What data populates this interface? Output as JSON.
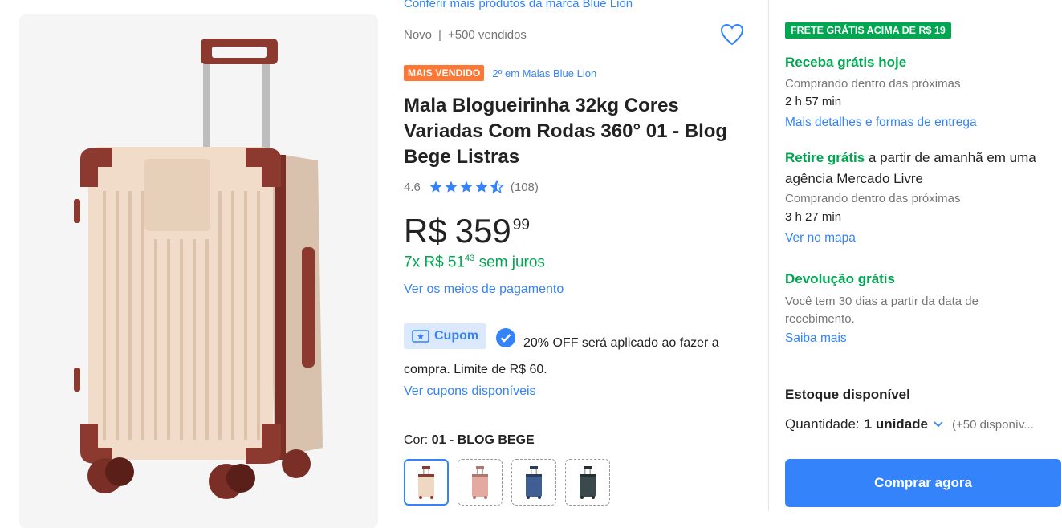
{
  "product": {
    "brand_link": "Conferir mais produtos da marca Blue Lion",
    "condition": "Novo",
    "sold": "+500 vendidos",
    "badge": "MAIS VENDIDO",
    "ranking": "2º em Malas Blue Lion",
    "title": "Mala Blogueirinha 32kg Cores Variadas Com Rodas 360° 01 - Blog Bege Listras",
    "rating": "4.6",
    "stars": 4.6,
    "reviews": "(108)",
    "price_currency": "R$",
    "price_int": "359",
    "price_cents": "99",
    "installments_prefix": "7x R$ 51",
    "installments_cents": "43",
    "installments_suffix": "sem juros",
    "payment_link": "Ver os meios de pagamento",
    "coupon_label": "Cupom",
    "coupon_text": "20% OFF será aplicado ao fazer a compra. Limite de R$ 60.",
    "coupons_link": "Ver cupons disponíveis",
    "color_label": "Cor:",
    "color_value": "01 - BLOG BEGE",
    "color_options": [
      {
        "color": "#eed8c4",
        "trim": "#8a3a2e"
      },
      {
        "color": "#e4a9a0",
        "trim": "#b07770"
      },
      {
        "color": "#3f5e94",
        "trim": "#2a3c5c"
      },
      {
        "color": "#3a4a4c",
        "trim": "#243030"
      }
    ]
  },
  "shipping": {
    "free_badge": "FRETE GRÁTIS ACIMA DE R$ 19",
    "receive_title": "Receba grátis hoje",
    "receive_sub": "Comprando dentro das próximas",
    "receive_time": "2 h 57 min",
    "receive_link": "Mais detalhes e formas de entrega",
    "pickup_bold": "Retire grátis",
    "pickup_text": " a partir de amanhã em uma agência Mercado Livre",
    "pickup_sub": "Comprando dentro das próximas",
    "pickup_time": "3 h 27 min",
    "pickup_link": "Ver no mapa",
    "return_title": "Devolução grátis",
    "return_text": "Você tem 30 dias a partir da data de recebimento.",
    "return_link": "Saiba mais",
    "stock_title": "Estoque disponível",
    "qty_label": "Quantidade:",
    "qty_value": "1 unidade",
    "qty_available": "(+50 disponív...",
    "buy_button": "Comprar agora"
  },
  "colors": {
    "accent": "#3483fa",
    "green": "#00a650",
    "badge_orange": "#ff7733"
  }
}
